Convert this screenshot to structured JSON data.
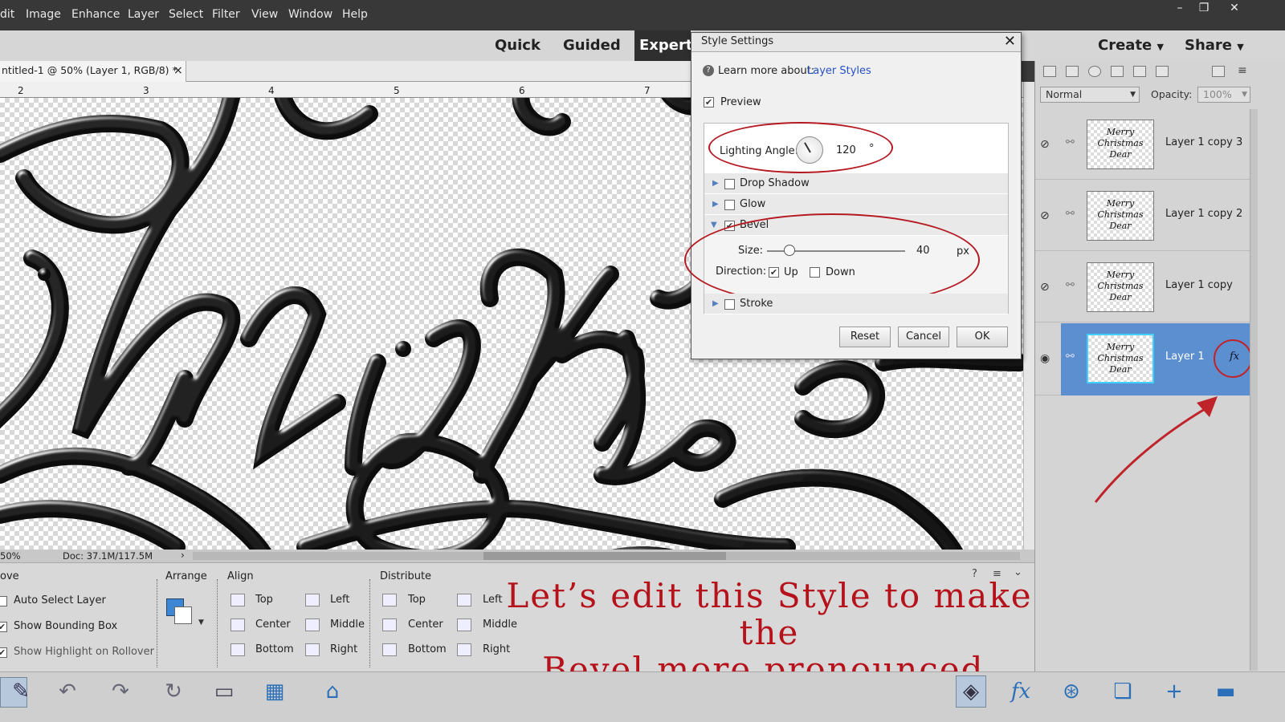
{
  "menubar": {
    "items": [
      "dit",
      "Image",
      "Enhance",
      "Layer",
      "Select",
      "Filter",
      "View",
      "Window",
      "Help"
    ],
    "window_buttons": [
      "–",
      "❐",
      "✕"
    ]
  },
  "modebar": {
    "modes": [
      "Quick",
      "Guided",
      "Expert"
    ],
    "create": "Create",
    "share": "Share"
  },
  "document": {
    "tab_title": "ntitled-1 @ 50% (Layer 1, RGB/8) *",
    "tab_close": "×",
    "ruler_ticks": [
      "2",
      "3",
      "4",
      "5",
      "6",
      "7"
    ],
    "zoom": "50%",
    "doc_size": "Doc: 37.1M/117.5M"
  },
  "dialog": {
    "title": "Style Settings",
    "close": "✕",
    "learn_more_label": "Learn more about:",
    "learn_more_link": "Layer Styles",
    "preview_label": "Preview",
    "preview_checked": true,
    "lighting_angle_label": "Lighting Angle:",
    "lighting_angle_value": "120",
    "degree_symbol": "°",
    "sections": [
      {
        "label": "Drop Shadow",
        "checked": false,
        "expanded": false
      },
      {
        "label": "Glow",
        "checked": false,
        "expanded": false
      },
      {
        "label": "Bevel",
        "checked": true,
        "expanded": true
      },
      {
        "label": "Stroke",
        "checked": false,
        "expanded": false
      }
    ],
    "bevel": {
      "size_label": "Size:",
      "size_value": "40",
      "size_unit": "px",
      "direction_label": "Direction:",
      "up_label": "Up",
      "up_checked": true,
      "down_label": "Down",
      "down_checked": false
    },
    "buttons": {
      "reset": "Reset",
      "cancel": "Cancel",
      "ok": "OK"
    }
  },
  "layers_panel": {
    "blend_mode": "Normal",
    "opacity_label": "Opacity:",
    "opacity_value": "100%",
    "layers": [
      {
        "name": "Layer 1 copy 3",
        "visible": false,
        "selected": false
      },
      {
        "name": "Layer 1 copy 2",
        "visible": false,
        "selected": false
      },
      {
        "name": "Layer 1 copy",
        "visible": false,
        "selected": false
      },
      {
        "name": "Layer 1",
        "visible": true,
        "selected": true,
        "fx": "fx"
      }
    ],
    "thumb_text": "Merry Christmas Dear"
  },
  "tool_options": {
    "move_heading": "ove",
    "auto_select": "Auto Select Layer",
    "show_bounding": "Show Bounding Box",
    "show_highlight": "Show Highlight on Rollover",
    "arrange_heading": "Arrange",
    "align_heading": "Align",
    "align_items": [
      "Top",
      "Center",
      "Bottom",
      "Left",
      "Middle",
      "Right"
    ],
    "distribute_heading": "Distribute",
    "distribute_items": [
      "Top",
      "Center",
      "Bottom",
      "Left",
      "Middle",
      "Right"
    ]
  },
  "annotation": {
    "line1": "Let’s edit this Style to make the",
    "line2": "Bevel more pronounced."
  },
  "colors": {
    "accent_red": "#b5121b",
    "selected_layer": "#5b8fd0",
    "link_blue": "#2650c8"
  }
}
